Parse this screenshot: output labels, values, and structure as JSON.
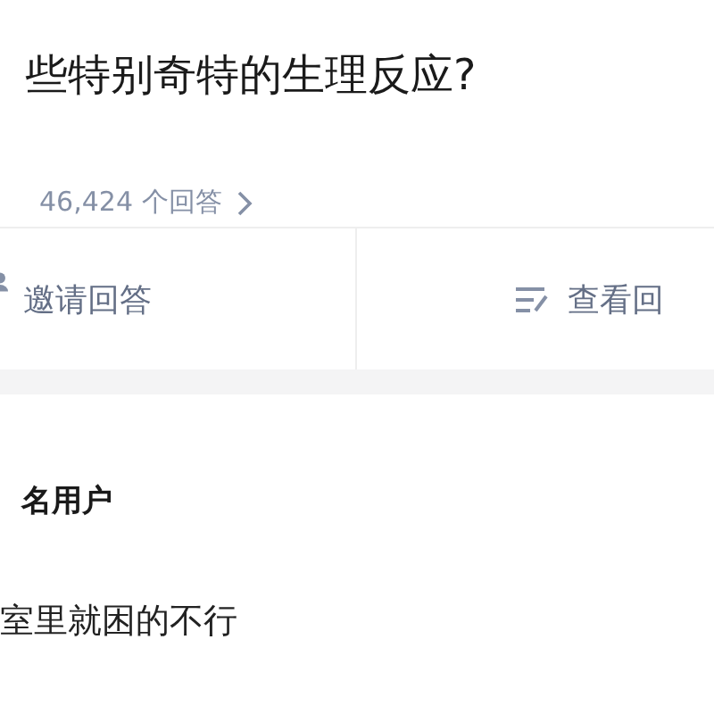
{
  "question": {
    "title": "些特别奇特的生理反应?",
    "answer_count": "46,424 个回答"
  },
  "actions": [
    {
      "kind": "invite",
      "label": "邀请回答"
    },
    {
      "kind": "view",
      "label": "查看回"
    }
  ],
  "answer": {
    "author": "名用户",
    "text": "室里就困的不行"
  }
}
